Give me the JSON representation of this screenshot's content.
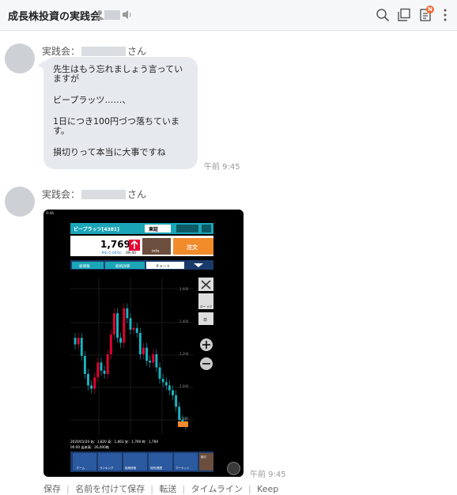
{
  "header": {
    "title": "成長株投資の実践会"
  },
  "messages": [
    {
      "sender_prefix": "実践会：",
      "sender_suffix": "さん",
      "lines": [
        "先生はもう忘れましょう言っていますが",
        "ビープラッツ……、",
        "1日につき100円づつ落ちています。",
        "損切りって本当に大事ですね"
      ],
      "time": "午前 9:45"
    },
    {
      "sender_prefix": "実践会：",
      "sender_suffix": "さん",
      "time": "午前 9:45"
    }
  ],
  "screenshot": {
    "status_time": "9:46",
    "stock_name": "ビープラッツ[4381]",
    "market": "東証",
    "price": "1,769",
    "change": "-94(-5.04%)",
    "price_time": "09:40",
    "info_label": "info",
    "order_label": "注文",
    "tabs": [
      "板情報",
      "銘柄詳細",
      "チャート"
    ],
    "price_ticks": [
      "2,600",
      "2,400",
      "2,200",
      "2,000",
      "1,800"
    ],
    "chart_data": {
      "type": "candlestick",
      "title": "",
      "ylim": [
        1700,
        2700
      ],
      "last_close": 1769,
      "closes": [
        2260,
        2300,
        2190,
        2080,
        2010,
        1990,
        2060,
        2150,
        2100,
        2080,
        2200,
        2320,
        2450,
        2300,
        2270,
        2480,
        2420,
        2350,
        2360,
        2330,
        2200,
        2240,
        2160,
        2150,
        2200,
        2120,
        2050,
        2030,
        2010,
        1980,
        1950,
        1880,
        1800,
        1790,
        1769
      ]
    },
    "ohlc_line": "2020/01/20 始：1,820 高：1,863 安：1,769 終：1,769",
    "volume_line": "00:00 出来高：26,000株",
    "tools": [
      "ロー ソク",
      "日"
    ],
    "bottom_nav": [
      "ホーム",
      "ランキング",
      "銘柄詳細",
      "保有/履歴",
      "マーケット",
      "取引"
    ]
  },
  "actions": [
    "保存",
    "名前を付けて保存",
    "転送",
    "タイムライン",
    "Keep"
  ],
  "colors": {
    "accent": "#f2662f",
    "bubble": "#e6e9ee",
    "teal": "#1aa6b7",
    "up": "#e60033"
  }
}
